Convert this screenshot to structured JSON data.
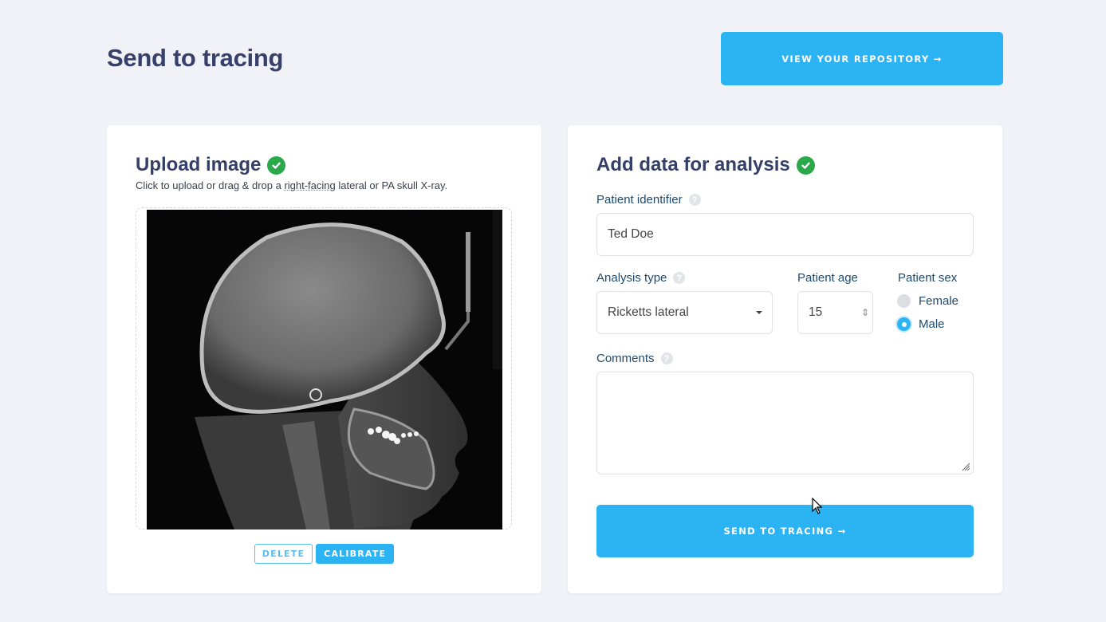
{
  "header": {
    "title": "Send to tracing",
    "repository_button": "VIEW YOUR REPOSITORY →"
  },
  "upload": {
    "title": "Upload image",
    "subtitle_pre": "Click to upload or drag & drop a ",
    "subtitle_abbr": "right-facing",
    "subtitle_post": " lateral or PA skull X-ray.",
    "delete_label": "DELETE",
    "calibrate_label": "CALIBRATE"
  },
  "analysis": {
    "title": "Add data for analysis",
    "patient_identifier_label": "Patient identifier",
    "patient_identifier_value": "Ted Doe",
    "analysis_type_label": "Analysis type",
    "analysis_type_value": "Ricketts lateral",
    "patient_age_label": "Patient age",
    "patient_age_value": "15",
    "patient_sex_label": "Patient sex",
    "sex_options": [
      {
        "label": "Female",
        "selected": false
      },
      {
        "label": "Male",
        "selected": true
      }
    ],
    "comments_label": "Comments",
    "comments_value": "",
    "send_button": "SEND TO TRACING →"
  },
  "colors": {
    "accent": "#2bb3f3",
    "success": "#2aa84a",
    "title": "#37406a",
    "background": "#f0f2f8"
  }
}
